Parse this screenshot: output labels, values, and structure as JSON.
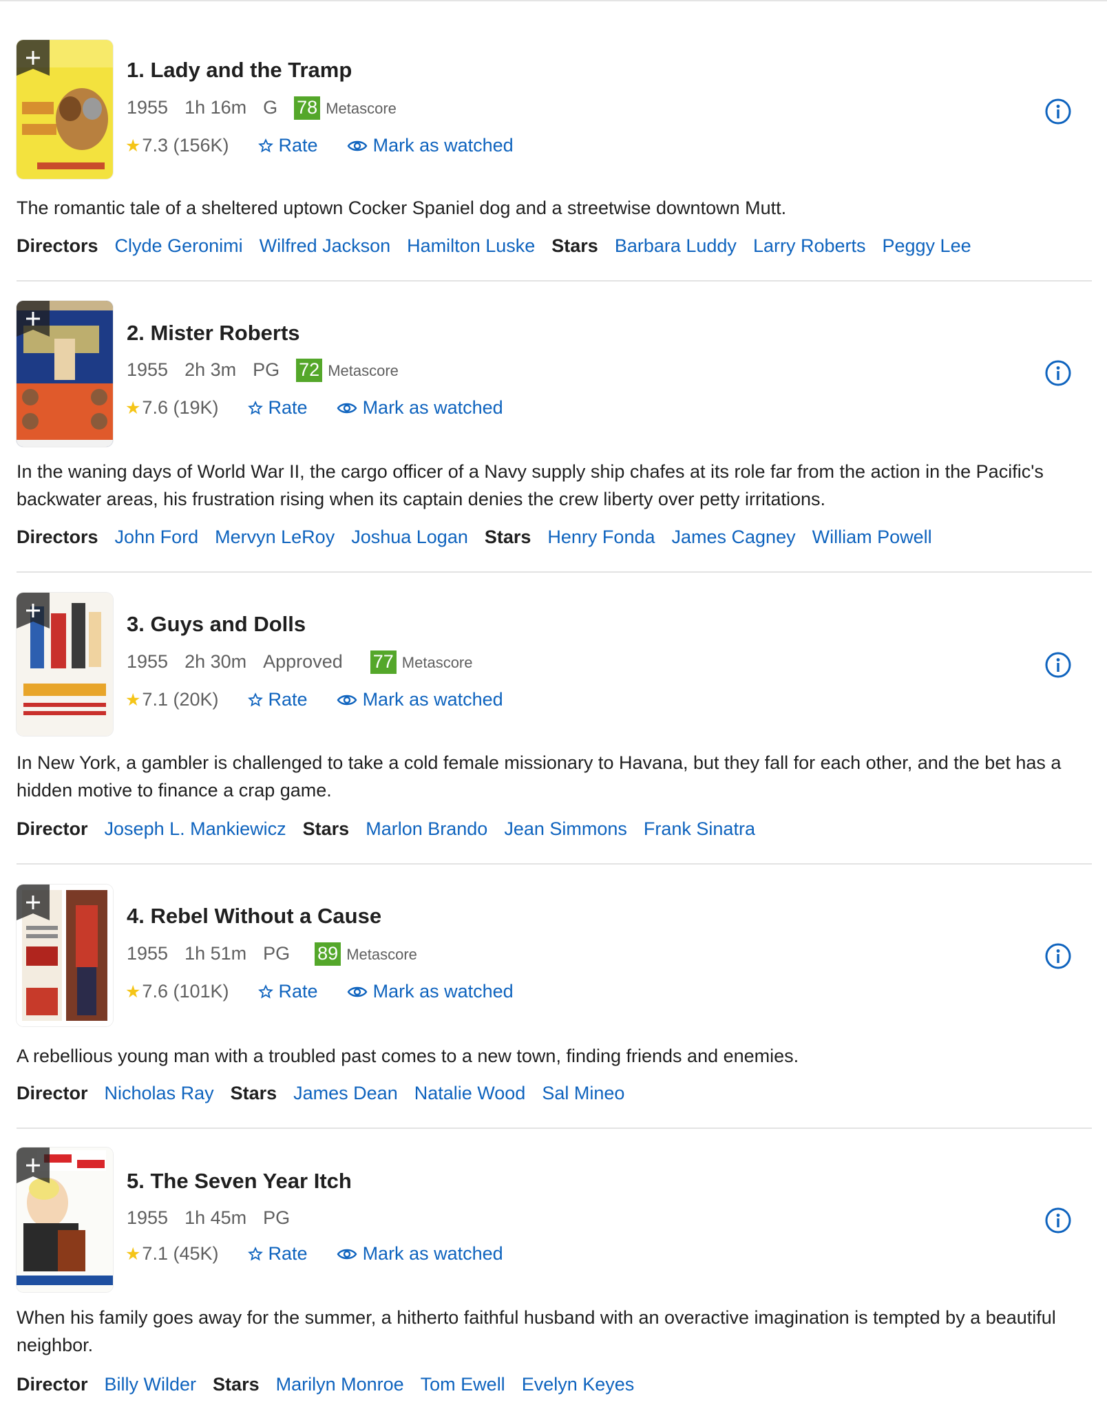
{
  "ui": {
    "rate_label": "Rate",
    "watched_label": "Mark as watched",
    "metascore_label": "Metascore"
  },
  "colors": {
    "link": "#0e63be",
    "metascore_bg": "#54a72a",
    "star": "#f5c518",
    "divider": "#e3e3e3"
  },
  "movies": [
    {
      "title": "1. Lady and the Tramp",
      "year": "1955",
      "runtime": "1h 16m",
      "rating": "G",
      "metascore": "78",
      "imdb_rating": "7.3",
      "votes": "(156K)",
      "description": "The romantic tale of a sheltered uptown Cocker Spaniel dog and a streetwise downtown Mutt.",
      "director_label": "Directors",
      "directors": [
        "Clyde Geronimi",
        "Wilfred Jackson",
        "Hamilton Luske"
      ],
      "stars_label": "Stars",
      "stars": [
        "Barbara Luddy",
        "Larry Roberts",
        "Peggy Lee"
      ]
    },
    {
      "title": "2. Mister Roberts",
      "year": "1955",
      "runtime": "2h 3m",
      "rating": "PG",
      "metascore": "72",
      "imdb_rating": "7.6",
      "votes": "(19K)",
      "description": "In the waning days of World War II, the cargo officer of a Navy supply ship chafes at its role far from the action in the Pacific's backwater areas, his frustration rising when its captain denies the crew liberty over petty irritations.",
      "director_label": "Directors",
      "directors": [
        "John Ford",
        "Mervyn LeRoy",
        "Joshua Logan"
      ],
      "stars_label": "Stars",
      "stars": [
        "Henry Fonda",
        "James Cagney",
        "William Powell"
      ]
    },
    {
      "title": "3. Guys and Dolls",
      "year": "1955",
      "runtime": "2h 30m",
      "rating": "Approved",
      "metascore": "77",
      "imdb_rating": "7.1",
      "votes": "(20K)",
      "description": "In New York, a gambler is challenged to take a cold female missionary to Havana, but they fall for each other, and the bet has a hidden motive to finance a crap game.",
      "director_label": "Director",
      "directors": [
        "Joseph L. Mankiewicz"
      ],
      "stars_label": "Stars",
      "stars": [
        "Marlon Brando",
        "Jean Simmons",
        "Frank Sinatra"
      ]
    },
    {
      "title": "4. Rebel Without a Cause",
      "year": "1955",
      "runtime": "1h 51m",
      "rating": "PG",
      "metascore": "89",
      "imdb_rating": "7.6",
      "votes": "(101K)",
      "description": "A rebellious young man with a troubled past comes to a new town, finding friends and enemies.",
      "director_label": "Director",
      "directors": [
        "Nicholas Ray"
      ],
      "stars_label": "Stars",
      "stars": [
        "James Dean",
        "Natalie Wood",
        "Sal Mineo"
      ]
    },
    {
      "title": "5. The Seven Year Itch",
      "year": "1955",
      "runtime": "1h 45m",
      "rating": "PG",
      "imdb_rating": "7.1",
      "votes": "(45K)",
      "description": "When his family goes away for the summer, a hitherto faithful husband with an overactive imagination is tempted by a beautiful neighbor.",
      "director_label": "Director",
      "directors": [
        "Billy Wilder"
      ],
      "stars_label": "Stars",
      "stars": [
        "Marilyn Monroe",
        "Tom Ewell",
        "Evelyn Keyes"
      ]
    }
  ]
}
